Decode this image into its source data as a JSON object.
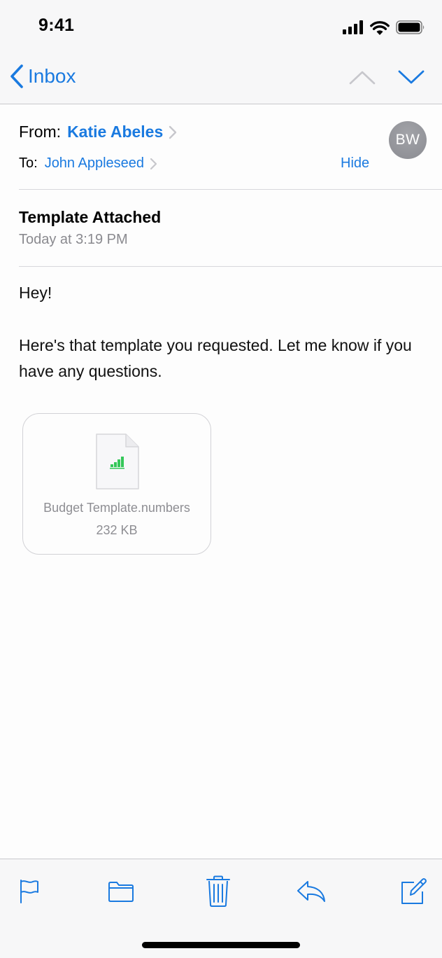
{
  "status_bar": {
    "time": "9:41"
  },
  "nav": {
    "back_label": "Inbox"
  },
  "header": {
    "from_label": "From:",
    "from_name": "Katie Abeles",
    "to_label": "To:",
    "to_name": "John Appleseed",
    "hide_label": "Hide",
    "avatar_initials": "BW"
  },
  "message": {
    "subject": "Template Attached",
    "date": "Today at 3:19 PM",
    "greeting": "Hey!",
    "body": "Here's that template you requested. Let me know if you have any questions."
  },
  "attachment": {
    "filename": "Budget Template.numbers",
    "size": "232 KB",
    "icon": "numbers-file-icon"
  },
  "toolbar": {
    "icons": [
      "flag-icon",
      "folder-icon",
      "trash-icon",
      "reply-icon",
      "compose-icon"
    ]
  },
  "colors": {
    "accent": "#1a7ae0",
    "secondary_text": "#8a8a8f",
    "avatar_bg": "#95969b",
    "numbers_green": "#34c759"
  }
}
